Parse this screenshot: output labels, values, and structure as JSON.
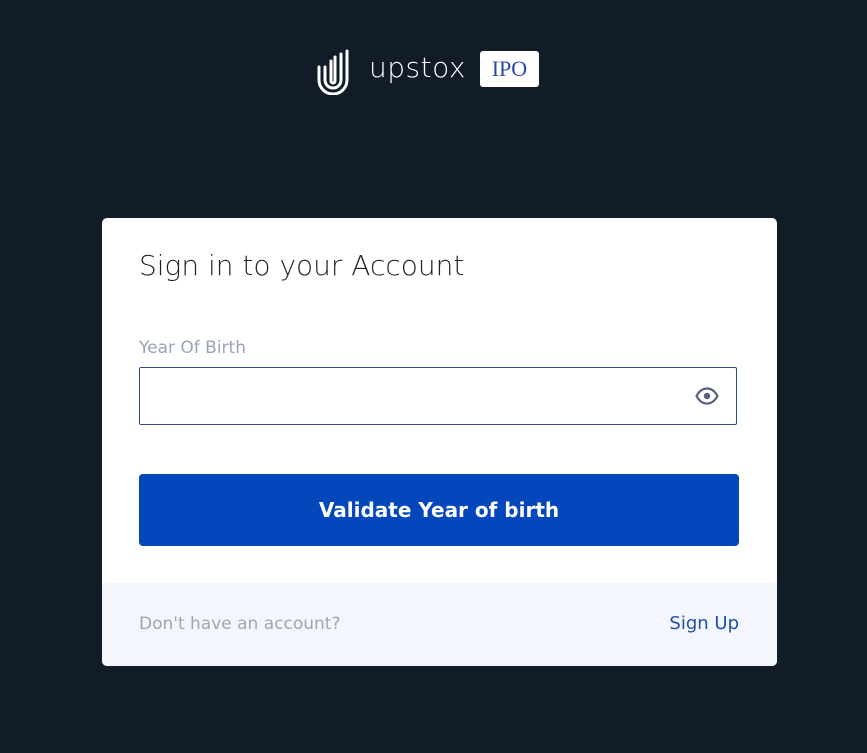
{
  "brand": {
    "logo_icon": "upstox-u-logo-icon",
    "name": "upstox",
    "badge": "IPO"
  },
  "login_card": {
    "title": "Sign in to your Account",
    "year_of_birth": {
      "label": "Year Of Birth",
      "value": "",
      "visibility_icon": "eye-icon"
    },
    "submit_label": "Validate Year of birth",
    "footer": {
      "prompt": "Don't have an account?",
      "signup_label": "Sign Up"
    }
  },
  "colors": {
    "page_background": "#111c28",
    "card_background": "#ffffff",
    "footer_background": "#f3f6fc",
    "primary_button": "#0447bd",
    "input_border": "#2f4d8a",
    "link": "#1f4fa8",
    "badge_text": "#2b4aa8"
  }
}
